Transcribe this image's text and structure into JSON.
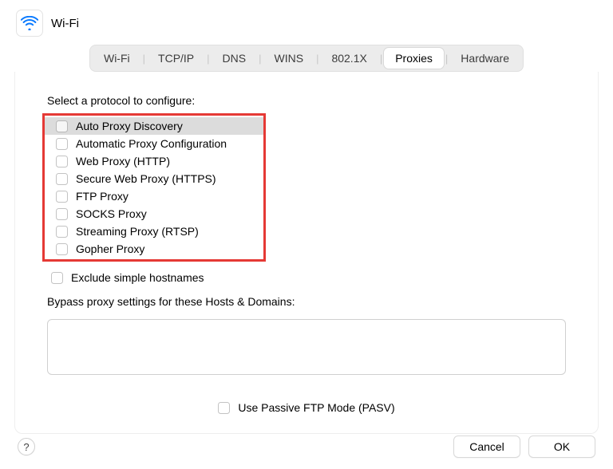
{
  "header": {
    "title": "Wi-Fi"
  },
  "tabs": [
    {
      "label": "Wi-Fi"
    },
    {
      "label": "TCP/IP"
    },
    {
      "label": "DNS"
    },
    {
      "label": "WINS"
    },
    {
      "label": "802.1X"
    },
    {
      "label": "Proxies"
    },
    {
      "label": "Hardware"
    }
  ],
  "active_tab": "Proxies",
  "proxies": {
    "select_label": "Select a protocol to configure:",
    "protocols": [
      {
        "label": "Auto Proxy Discovery",
        "checked": false,
        "selected": true
      },
      {
        "label": "Automatic Proxy Configuration",
        "checked": false,
        "selected": false
      },
      {
        "label": "Web Proxy (HTTP)",
        "checked": false,
        "selected": false
      },
      {
        "label": "Secure Web Proxy (HTTPS)",
        "checked": false,
        "selected": false
      },
      {
        "label": "FTP Proxy",
        "checked": false,
        "selected": false
      },
      {
        "label": "SOCKS Proxy",
        "checked": false,
        "selected": false
      },
      {
        "label": "Streaming Proxy (RTSP)",
        "checked": false,
        "selected": false
      },
      {
        "label": "Gopher Proxy",
        "checked": false,
        "selected": false
      }
    ],
    "exclude_simple_label": "Exclude simple hostnames",
    "exclude_simple_checked": false,
    "bypass_label": "Bypass proxy settings for these Hosts & Domains:",
    "bypass_value": "",
    "pasv_label": "Use Passive FTP Mode (PASV)",
    "pasv_checked": false
  },
  "footer": {
    "help": "?",
    "cancel": "Cancel",
    "ok": "OK"
  },
  "highlight_color": "#e53935"
}
